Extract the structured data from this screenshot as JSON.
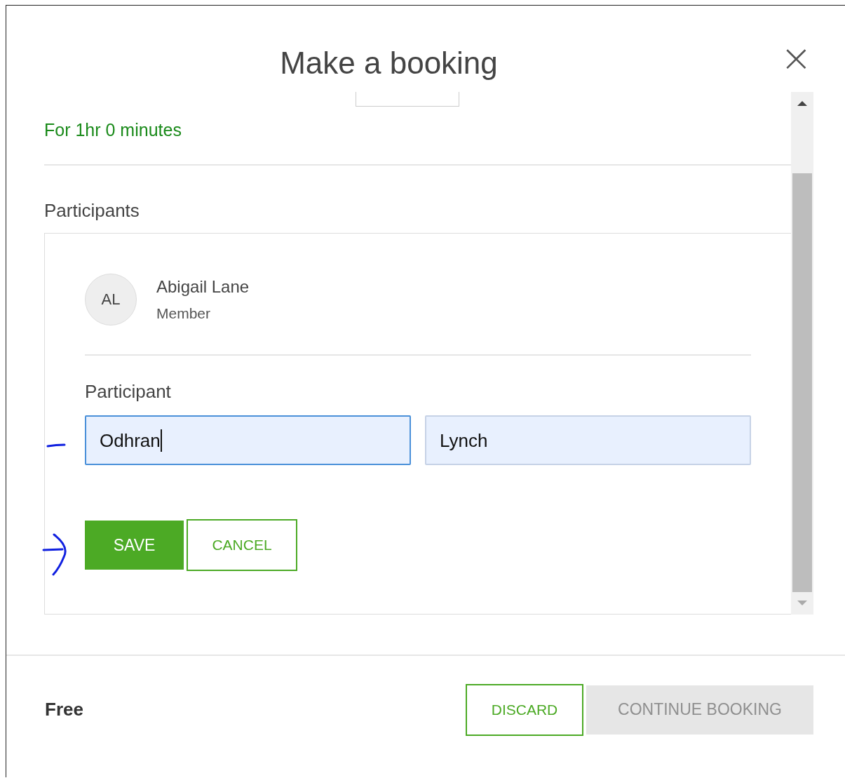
{
  "dialog": {
    "title": "Make a booking",
    "close": "×"
  },
  "duration": "For 1hr 0 minutes",
  "participants": {
    "heading": "Participants",
    "members": [
      {
        "initials": "AL",
        "name": "Abigail Lane",
        "role": "Member"
      }
    ],
    "form": {
      "label": "Participant",
      "inputs": [
        {
          "value": "Odhran",
          "focused": true
        },
        {
          "value": "Lynch",
          "focused": false
        }
      ],
      "buttons": [
        {
          "label": "SAVE",
          "kind": "primary"
        },
        {
          "label": "CANCEL",
          "kind": "outline"
        }
      ]
    }
  },
  "footer": {
    "price": "Free",
    "buttons": [
      {
        "label": "DISCARD",
        "kind": "outline",
        "disabled": false
      },
      {
        "label": "CONTINUE BOOKING",
        "kind": "primary",
        "disabled": true
      }
    ]
  }
}
